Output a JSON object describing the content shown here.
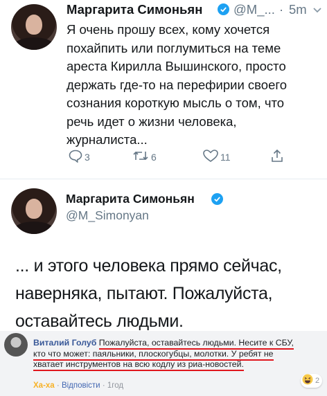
{
  "tweet1": {
    "author": "Маргарита Симоньян",
    "handle": "@M_...",
    "dot": "·",
    "time": "5m",
    "text": "Я очень прошу всех, кому хочется\nпохайпить или поглумиться на теме\nареста Кирилла Вышинского, просто\nдержать где-то на перефирии своего\nсознания короткую мысль о том, что\nречь идет о жизни человека,\nжурналиста...",
    "actions": {
      "reply_count": "3",
      "retweet_count": "6",
      "like_count": "11"
    }
  },
  "tweet2": {
    "author": "Маргарита Симоньян",
    "handle": "@M_Simonyan",
    "text": "... и этого человека прямо сейчас,\nнаверняка, пытают. Пожалуйста,\nоставайтесь людьми."
  },
  "comment": {
    "author": "Виталий Голуб",
    "line1": "Пожалуйста, оставайтесь людьми. Несите к СБУ,",
    "line2": "кто что может: паяльники, плоскогубцы, молотки. У ребят не",
    "line3": "хватает инструментов на всю кодлу из риа-новостей.",
    "reaction_link": "Ха-ха",
    "reply_link": "Відповісти",
    "time": "1год",
    "reaction_count": "2",
    "sep": "·"
  },
  "colors": {
    "verified": "#1da1f2",
    "underline": "#e0161d",
    "fb_link": "#385898"
  }
}
